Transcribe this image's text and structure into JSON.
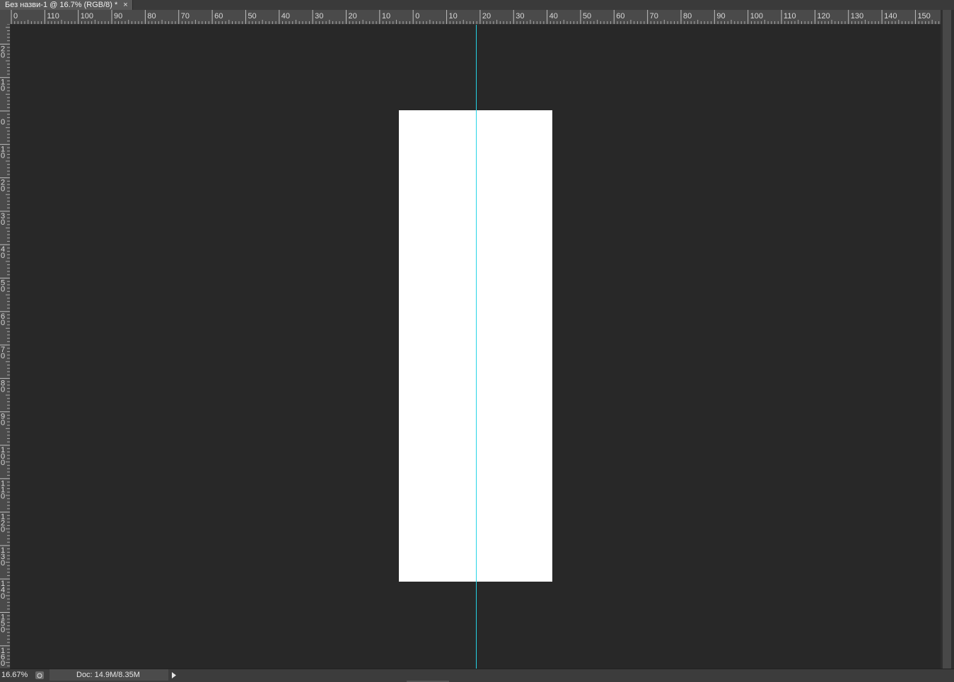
{
  "tab": {
    "title": "Без назви-1 @ 16.7% (RGB/8) *",
    "close": "×"
  },
  "rulers": {
    "horizontal_labels": [
      "0",
      "110",
      "100",
      "90",
      "80",
      "70",
      "60",
      "50",
      "40",
      "30",
      "20",
      "10",
      "0",
      "10",
      "20",
      "30",
      "40",
      "50",
      "60",
      "70",
      "80",
      "90",
      "100",
      "110",
      "120",
      "130",
      "140",
      "150",
      "1"
    ],
    "vertical_labels": [
      [
        "",
        ""
      ],
      [
        "2",
        "0"
      ],
      [
        "1",
        "0"
      ],
      [
        "",
        "0"
      ],
      [
        "1",
        "0"
      ],
      [
        "2",
        "0"
      ],
      [
        "3",
        "0"
      ],
      [
        "4",
        "0"
      ],
      [
        "5",
        "0"
      ],
      [
        "6",
        "0"
      ],
      [
        "7",
        "0"
      ],
      [
        "8",
        "0"
      ],
      [
        "9",
        "0"
      ],
      [
        "1",
        "0",
        "0"
      ],
      [
        "1",
        "1",
        "0"
      ],
      [
        "1",
        "2",
        "0"
      ],
      [
        "1",
        "3",
        "0"
      ],
      [
        "1",
        "4",
        "0"
      ],
      [
        "1",
        "5",
        "0"
      ],
      [
        "1",
        "6",
        "0"
      ]
    ]
  },
  "colors": {
    "workspace": "#282828",
    "artboard": "#ffffff",
    "guide": "#25d4e6"
  },
  "status": {
    "zoom": "16.67%",
    "doc_info": "Doc: 14.9M/8.35M"
  }
}
